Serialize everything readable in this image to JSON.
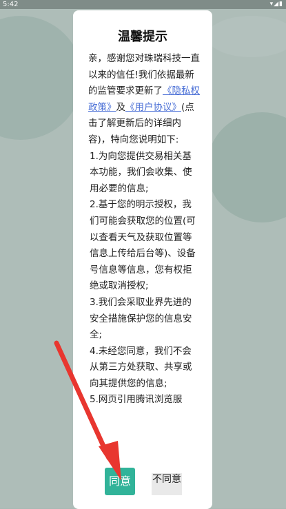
{
  "status_bar": {
    "time": "5:42",
    "icons": "wifi signal battery"
  },
  "dialog": {
    "title": "温馨提示",
    "intro_before_link1": "亲，感谢您对珠瑞科技一直以来的信任!我们依据最新的监管要求更新了",
    "link1": "《隐私权政策》",
    "and": "及",
    "link2": "《用户协议》",
    "intro_after_links": "(点击了解更新后的详细内容)，特向您说明如下:",
    "items": [
      "1.为向您提供交易相关基本功能，我们会收集、使用必要的信息;",
      "2.基于您的明示授权，我们可能会获取您的位置(可以查看天气及获取位置等信息上传给后台等)、设备号信息等信息，您有权拒绝或取消授权;",
      "3.我们会采取业界先进的安全措施保护您的信息安全;",
      "4.未经您同意，我们不会从第三方处获取、共享或向其提供您的信息;",
      "5.网页引用腾讯浏览服"
    ],
    "agree_label": "同意",
    "disagree_label": "不同意"
  },
  "colors": {
    "agree": "#31b399",
    "link": "#4a6fd6",
    "arrow": "#e8362f"
  }
}
